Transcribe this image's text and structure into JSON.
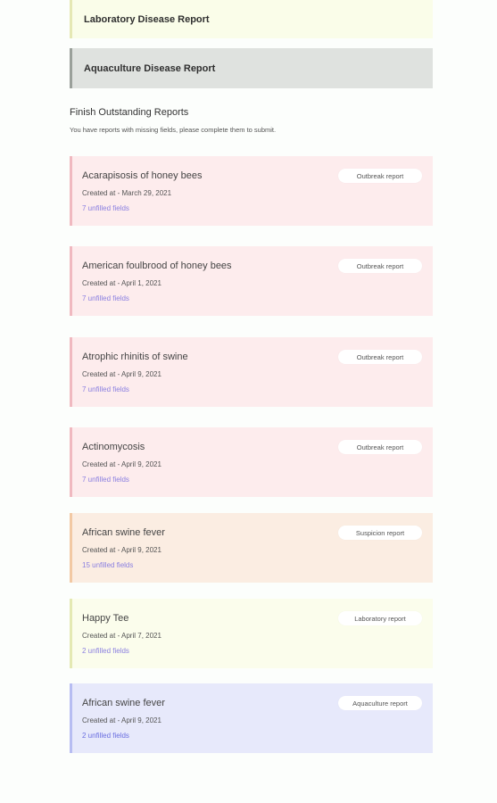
{
  "links": {
    "laboratory": "Laboratory Disease Report",
    "aquaculture": "Aquaculture Disease Report"
  },
  "outstanding": {
    "title": "Finish Outstanding Reports",
    "subtitle": "You have reports with missing fields, please complete them to submit."
  },
  "cards": [
    {
      "name": "Acarapisosis of honey bees",
      "created": "Created at - March 29, 2021",
      "unfilled": "7 unfilled fields",
      "badge": "Outbreak report"
    },
    {
      "name": "American foulbrood of honey bees",
      "created": "Created at - April 1, 2021",
      "unfilled": "7 unfilled fields",
      "badge": "Outbreak report"
    },
    {
      "name": "Atrophic rhinitis of swine",
      "created": "Created at - April 9, 2021",
      "unfilled": "7 unfilled fields",
      "badge": "Outbreak report"
    },
    {
      "name": "Actinomycosis",
      "created": "Created at - April 9, 2021",
      "unfilled": "7 unfilled fields",
      "badge": "Outbreak report"
    },
    {
      "name": "African swine fever",
      "created": "Created at - April 9, 2021",
      "unfilled": "15 unfilled fields",
      "badge": "Suspicion report"
    },
    {
      "name": "Happy Tee",
      "created": "Created at - April 7, 2021",
      "unfilled": "2 unfilled fields",
      "badge": "Laboratory report"
    },
    {
      "name": "African swine fever",
      "created": "Created at - April 9, 2021",
      "unfilled": "2 unfilled fields",
      "badge": "Aquaculture report"
    }
  ],
  "colors": {
    "outbreak_bg": "#fdeced",
    "suspicion_bg": "#fbede2",
    "laboratory_bg": "#fbfdec",
    "aquaculture_bg": "#e7e9fb",
    "unfilled_text": "#8a7fe0"
  }
}
